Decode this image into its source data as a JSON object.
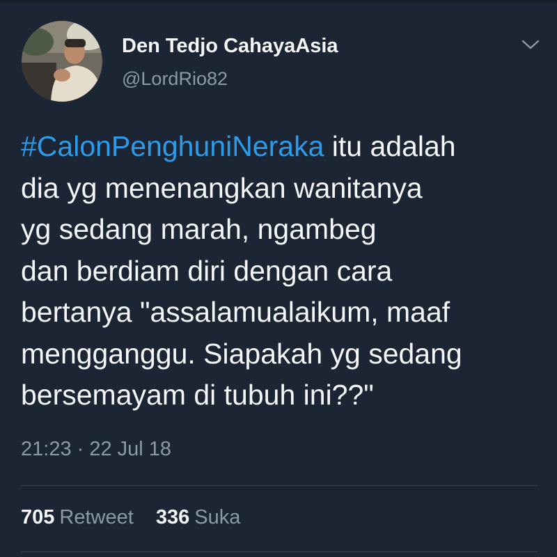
{
  "author": {
    "display_name": "Den Tedjo CahayaAsia",
    "handle": "@LordRio82",
    "avatar": "profile-photo"
  },
  "menu_icon": "chevron-down-icon",
  "tweet": {
    "lines": [
      {
        "hashtag": "#CalonPenghuniNeraka",
        "text": " itu adalah"
      },
      {
        "text": "dia yg menenangkan wanitanya"
      },
      {
        "text": "yg sedang marah, ngambeg"
      },
      {
        "text": "dan berdiam diri dengan cara"
      },
      {
        "text": "bertanya \"assalamualaikum, maaf"
      },
      {
        "text": "mengganggu. Siapakah yg sedang"
      },
      {
        "text": "bersemayam di tubuh ini??\""
      }
    ],
    "timestamp": "21:23 · 22 Jul 18"
  },
  "stats": {
    "retweets": {
      "count": "705",
      "label": "Retweet"
    },
    "likes": {
      "count": "336",
      "label": "Suka"
    }
  },
  "colors": {
    "background": "#1b2533",
    "text": "#f4f6f8",
    "secondary_text": "#8d99a6",
    "link": "#2b9bea",
    "divider": "#38444d"
  }
}
